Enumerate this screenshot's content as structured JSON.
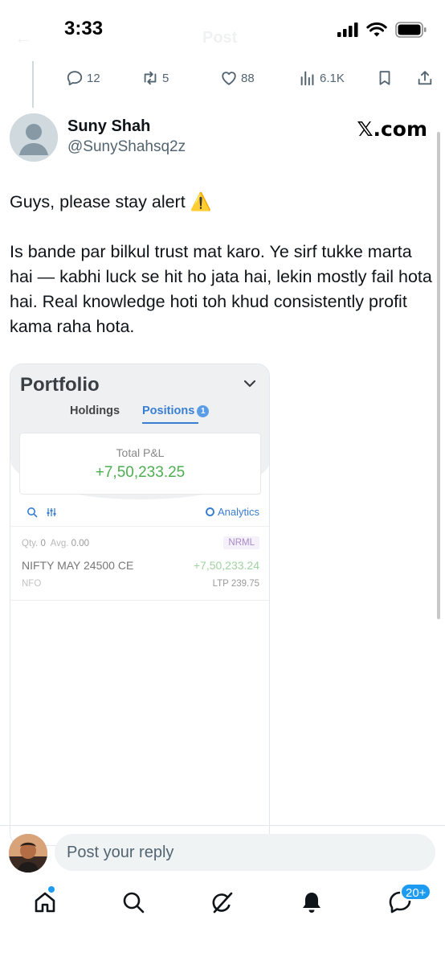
{
  "status_bar": {
    "time": "3:33"
  },
  "header": {
    "title": "Post"
  },
  "actions": {
    "replies": "12",
    "reposts": "5",
    "likes": "88",
    "views": "6.1K"
  },
  "author": {
    "name": "Suny Shah",
    "handle": "@SunyShahsq2z"
  },
  "brand": "𝕏.com",
  "tweet": {
    "line1": "Guys, please stay alert ⚠️",
    "line2": "Is bande par bilkul trust mat karo. Ye sirf tukke marta hai — kabhi luck se hit ho jata hai, lekin mostly fail hota hai. Real knowledge hoti toh khud consistently profit kama raha hota."
  },
  "portfolio": {
    "title": "Portfolio",
    "tab_holdings": "Holdings",
    "tab_positions": "Positions",
    "positions_count": "1",
    "total_label": "Total P&L",
    "total_value": "+7,50,233.25",
    "analytics": "Analytics",
    "position": {
      "qty_label": "Qty.",
      "qty": "0",
      "avg_label": "Avg.",
      "avg": "0.00",
      "product": "NRML",
      "instrument": "NIFTY MAY 24500 CE",
      "pnl": "+7,50,233.24",
      "exchange": "NFO",
      "ltp_label": "LTP",
      "ltp": "239.75"
    }
  },
  "reply": {
    "placeholder": "Post your reply"
  },
  "nav": {
    "messages_badge": "20+"
  },
  "colors": {
    "accent": "#1d9bf0",
    "profit_green": "#4caf50",
    "kite_blue": "#387ed1"
  }
}
